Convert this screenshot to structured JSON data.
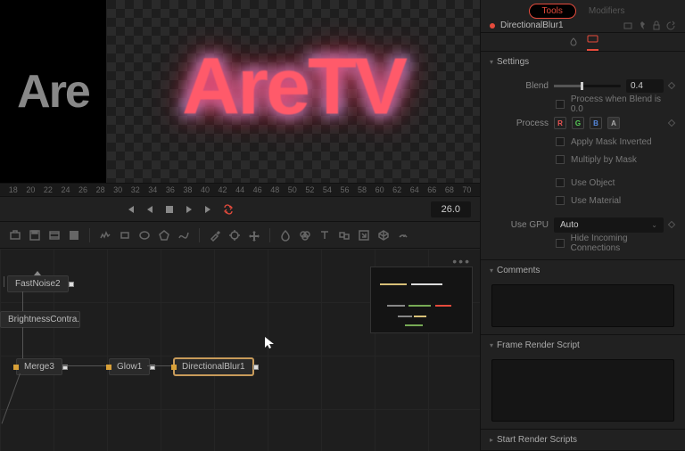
{
  "preview": {
    "text_a": "Are",
    "text_b": "AreTV"
  },
  "ruler": [
    "18",
    "20",
    "22",
    "24",
    "26",
    "28",
    "30",
    "32",
    "34",
    "36",
    "38",
    "40",
    "42",
    "44",
    "46",
    "48",
    "50",
    "52",
    "54",
    "56",
    "58",
    "60",
    "62",
    "64",
    "66",
    "68",
    "70"
  ],
  "transport": {
    "timecode": "26.0"
  },
  "nodes": {
    "fastnoise": "FastNoise2",
    "bc": "BrightnessContra...",
    "merge": "Merge3",
    "glow": "Glow1",
    "dblur": "DirectionalBlur1"
  },
  "inspector": {
    "tabs": {
      "tools": "Tools",
      "modifiers": "Modifiers"
    },
    "node_name": "DirectionalBlur1",
    "sections": {
      "settings": "Settings",
      "comments": "Comments",
      "frs": "Frame Render Script",
      "srs": "Start Render Scripts"
    },
    "props": {
      "blend_label": "Blend",
      "blend_value": "0.4",
      "process_blend0": "Process when Blend is 0.0",
      "process_label": "Process",
      "ch_r": "R",
      "ch_g": "G",
      "ch_b": "B",
      "ch_a": "A",
      "apply_mask_inv": "Apply Mask Inverted",
      "mult_by_mask": "Multiply by Mask",
      "use_object": "Use Object",
      "use_material": "Use Material",
      "use_gpu_label": "Use GPU",
      "use_gpu_value": "Auto",
      "hide_conn": "Hide Incoming Connections"
    }
  }
}
